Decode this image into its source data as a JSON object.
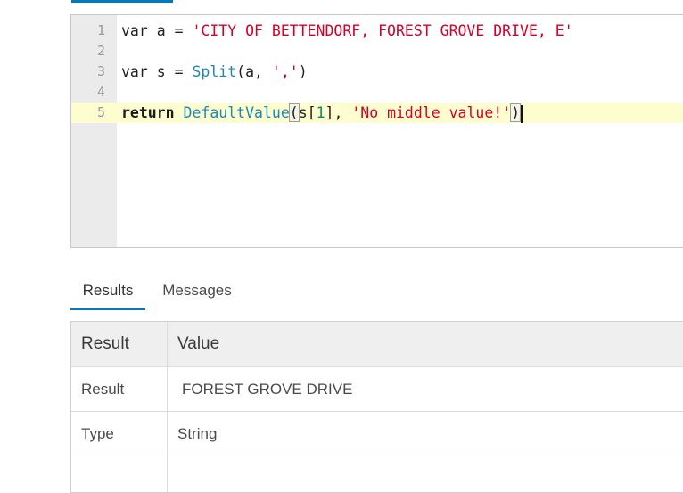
{
  "editor": {
    "line_numbers": [
      "1",
      "2",
      "3",
      "4",
      "5"
    ],
    "line1": {
      "kw": "var",
      "rest": " a = ",
      "str": "'CITY OF BETTENDORF, FOREST GROVE DRIVE, E'"
    },
    "line3": {
      "kw": "var",
      "rest": " s = ",
      "fn": "Split",
      "args_open": "(a, ",
      "str": "','",
      "close": ")"
    },
    "line5": {
      "kw": "return",
      "space": " ",
      "fn": "DefaultValue",
      "open": "(",
      "arg1": "s[",
      "index": "1",
      "arg1_close": "], ",
      "str": "'No middle value!'",
      "close": ")"
    }
  },
  "tabs": [
    {
      "label": "Results",
      "active": true
    },
    {
      "label": "Messages",
      "active": false
    }
  ],
  "results": {
    "header": {
      "key": "Result",
      "value": "Value"
    },
    "rows": [
      {
        "key": "Result",
        "value": "FOREST GROVE DRIVE"
      },
      {
        "key": "Type",
        "value": "String"
      }
    ]
  }
}
